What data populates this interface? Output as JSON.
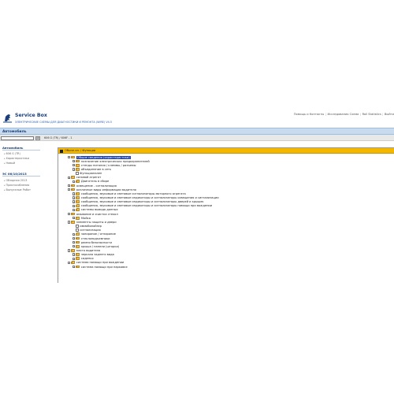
{
  "top_links": [
    "Помощь и Контакты",
    "Исследования Схема",
    "Roll Statistics",
    "Выйти"
  ],
  "brand": {
    "title": "Service Box",
    "subtitle": "ЭЛЕКТРИЧЕСКИЕ СХЕМЫ ДЛЯ ДИАГНОСТИКИ И РЕМОНТА (WIRE) V4.5"
  },
  "bluebar_title": "Автомобиль",
  "search": {
    "value": "",
    "go_label": "ok"
  },
  "breadcrumb": "606 G (TR)  /  606F - 1",
  "left": {
    "section1_title": "Автомобиль",
    "section1_items": [
      "606 G (TR)",
      "Характеристики",
      "Новый"
    ],
    "section2_title": "ЭС 06/10/2013",
    "section2_items": [
      "Обзорная 2013",
      "Приспособления",
      "Выпускные Работ"
    ]
  },
  "panel": {
    "breadcrumb": "Обычн.эл. / Функции"
  },
  "tree": [
    {
      "level": 0,
      "toggle": "-",
      "icon": "folder",
      "label": "Общие сведения (характеристики)",
      "selected": true
    },
    {
      "level": 1,
      "toggle": "+",
      "icon": "folder",
      "label": "назначение электрических предохранителей"
    },
    {
      "level": 1,
      "toggle": "+",
      "icon": "folder",
      "label": "стенды питания / клеммы / разъемы"
    },
    {
      "level": 1,
      "toggle": "+",
      "icon": "folder",
      "label": "объединение в сеть"
    },
    {
      "level": 1,
      "toggle": "",
      "icon": "doc",
      "label": "Функционален"
    },
    {
      "level": 0,
      "toggle": "+",
      "icon": "folder",
      "label": "силовой агрегат"
    },
    {
      "level": 1,
      "toggle": "+",
      "icon": "folder",
      "label": "Двигатель в сборе"
    },
    {
      "level": 0,
      "toggle": "+",
      "icon": "folder",
      "label": "освещение - сигнализация"
    },
    {
      "level": 0,
      "toggle": "-",
      "icon": "folder",
      "label": "различные виды информации водителя"
    },
    {
      "level": 1,
      "toggle": "+",
      "icon": "folder",
      "label": "сообщения, звуковые и световые сигнализаторы моторного агрегата"
    },
    {
      "level": 1,
      "toggle": "+",
      "icon": "folder",
      "label": "сообщения, звуковые и световые индикаторы и сигнализаторы освещения и сигнализации"
    },
    {
      "level": 1,
      "toggle": "+",
      "icon": "folder",
      "label": "сообщения, звуковые и световые индикаторы и сигнализаторы дверей и крышек"
    },
    {
      "level": 1,
      "toggle": "+",
      "icon": "folder",
      "label": "сообщения, звуковые и световые индикаторы и сигнализаторы помощи при вождении"
    },
    {
      "level": 1,
      "toggle": "+",
      "icon": "folder",
      "label": "системы вывода данных"
    },
    {
      "level": 0,
      "toggle": "-",
      "icon": "folder",
      "label": "омывание и очистка стекол"
    },
    {
      "level": 1,
      "toggle": "+",
      "icon": "folder",
      "label": "Мойка"
    },
    {
      "level": 0,
      "toggle": "-",
      "icon": "folder",
      "label": "элементы защиты и двери"
    },
    {
      "level": 1,
      "toggle": "",
      "icon": "doc",
      "label": "иммобилайзер"
    },
    {
      "level": 1,
      "toggle": "",
      "icon": "doc",
      "label": "сигнализация"
    },
    {
      "level": 1,
      "toggle": "+",
      "icon": "folder",
      "label": "запирание / отпирание"
    },
    {
      "level": 1,
      "toggle": "+",
      "icon": "folder",
      "label": "стеклоподъемники"
    },
    {
      "level": 1,
      "toggle": "+",
      "icon": "folder",
      "label": "ремни безопасности"
    },
    {
      "level": 1,
      "toggle": "+",
      "icon": "folder",
      "label": "крыша / панели (шторки)"
    },
    {
      "level": 0,
      "toggle": "-",
      "icon": "folder",
      "label": "место водителя"
    },
    {
      "level": 1,
      "toggle": "+",
      "icon": "folder",
      "label": "зеркала заднего вида"
    },
    {
      "level": 1,
      "toggle": "+",
      "icon": "folder",
      "label": "сиденья"
    },
    {
      "level": 0,
      "toggle": "-",
      "icon": "folder",
      "label": "система помощи при вождении"
    },
    {
      "level": 1,
      "toggle": "+",
      "icon": "folder",
      "label": "система помощи при парковке"
    }
  ]
}
